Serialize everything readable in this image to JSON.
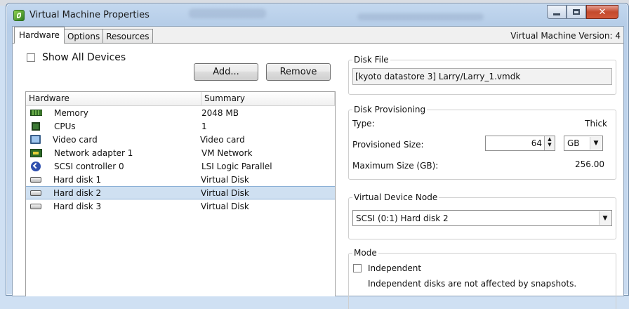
{
  "window": {
    "title": "Virtual Machine Properties",
    "version_label": "Virtual Machine Version: 4"
  },
  "tabs": [
    "Hardware",
    "Options",
    "Resources"
  ],
  "toolbar": {
    "show_all_label": "Show All Devices",
    "add_label": "Add...",
    "remove_label": "Remove"
  },
  "hardware": {
    "col_hardware": "Hardware",
    "col_summary": "Summary",
    "rows": [
      {
        "name": "Memory",
        "summary": "2048 MB",
        "icon": "memory-icon"
      },
      {
        "name": "CPUs",
        "summary": "1",
        "icon": "cpu-icon"
      },
      {
        "name": "Video card",
        "summary": "Video card",
        "icon": "video-card-icon"
      },
      {
        "name": "Network adapter 1",
        "summary": "VM Network",
        "icon": "network-adapter-icon"
      },
      {
        "name": "SCSI controller 0",
        "summary": "LSI Logic Parallel",
        "icon": "scsi-controller-icon"
      },
      {
        "name": "Hard disk 1",
        "summary": "Virtual Disk",
        "icon": "hard-disk-icon"
      },
      {
        "name": "Hard disk 2",
        "summary": "Virtual Disk",
        "icon": "hard-disk-icon",
        "selected": true
      },
      {
        "name": "Hard disk 3",
        "summary": "Virtual Disk",
        "icon": "hard-disk-icon"
      }
    ],
    "selection_color": "#cfe0f1"
  },
  "disk_file": {
    "legend": "Disk File",
    "value": "[kyoto datastore 3] Larry/Larry_1.vmdk"
  },
  "provisioning": {
    "legend": "Disk Provisioning",
    "type_label": "Type:",
    "type_value": "Thick",
    "size_label": "Provisioned Size:",
    "size_value": "64",
    "unit_value": "GB",
    "max_label": "Maximum Size (GB):",
    "max_value": "256.00"
  },
  "vdn": {
    "legend": "Virtual Device Node",
    "value": "SCSI (0:1) Hard disk 2"
  },
  "mode": {
    "legend": "Mode",
    "independent_label": "Independent",
    "note": "Independent disks are not affected by snapshots."
  },
  "colors": {
    "close_button": "#c44a2d",
    "titlebar": "#c3d8ef"
  }
}
